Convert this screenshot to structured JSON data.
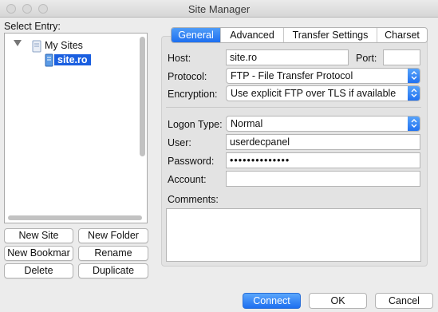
{
  "window": {
    "title": "Site Manager"
  },
  "left": {
    "select_entry_label": "Select Entry:",
    "tree": {
      "root_label": "My Sites",
      "site_label": "site.ro"
    },
    "buttons": {
      "new_site": "New Site",
      "new_folder": "New Folder",
      "new_bookmark": "New Bookmar",
      "rename": "Rename",
      "delete": "Delete",
      "duplicate": "Duplicate"
    }
  },
  "tabs": [
    "General",
    "Advanced",
    "Transfer Settings",
    "Charset"
  ],
  "general": {
    "host_label": "Host:",
    "host_value": "site.ro",
    "port_label": "Port:",
    "port_value": "",
    "protocol_label": "Protocol:",
    "protocol_value": "FTP - File Transfer Protocol",
    "encryption_label": "Encryption:",
    "encryption_value": "Use explicit FTP over TLS if available",
    "logon_type_label": "Logon Type:",
    "logon_type_value": "Normal",
    "user_label": "User:",
    "user_value": "userdecpanel",
    "password_label": "Password:",
    "password_value": "••••••••••••••",
    "account_label": "Account:",
    "account_value": "",
    "comments_label": "Comments:",
    "comments_value": ""
  },
  "footer": {
    "connect": "Connect",
    "ok": "OK",
    "cancel": "Cancel"
  },
  "colors": {
    "accent": "#1d6ff0",
    "selection": "#1a5fe0"
  }
}
